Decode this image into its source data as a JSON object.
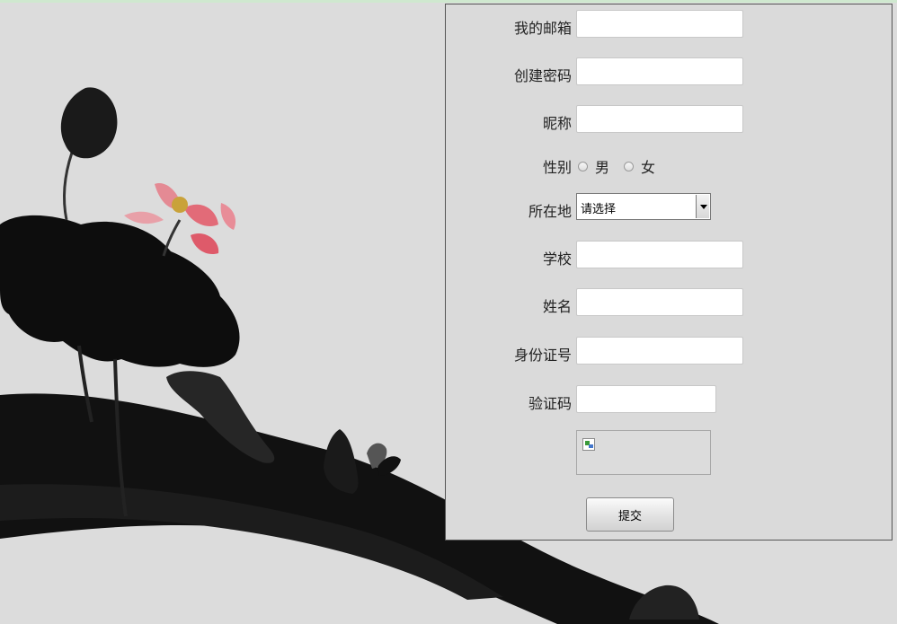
{
  "form": {
    "email_label": "我的邮箱",
    "email_value": "",
    "password_label": "创建密码",
    "password_value": "",
    "nickname_label": "昵称",
    "nickname_value": "",
    "gender_label": "性别",
    "gender_options": [
      "男",
      "女"
    ],
    "location_label": "所在地",
    "location_selected": "请选择",
    "school_label": "学校",
    "school_value": "",
    "name_label": "姓名",
    "name_value": "",
    "id_label": "身份证号",
    "id_value": "",
    "captcha_label": "验证码",
    "captcha_value": "",
    "submit_label": "提交"
  },
  "icons": {
    "captcha_image": "broken-image-icon",
    "select_arrow": "chevron-down-icon"
  },
  "colors": {
    "background": "#dcdcdc",
    "panel_border": "#555555",
    "ink": "#111111",
    "lotus": "#e26b78"
  }
}
